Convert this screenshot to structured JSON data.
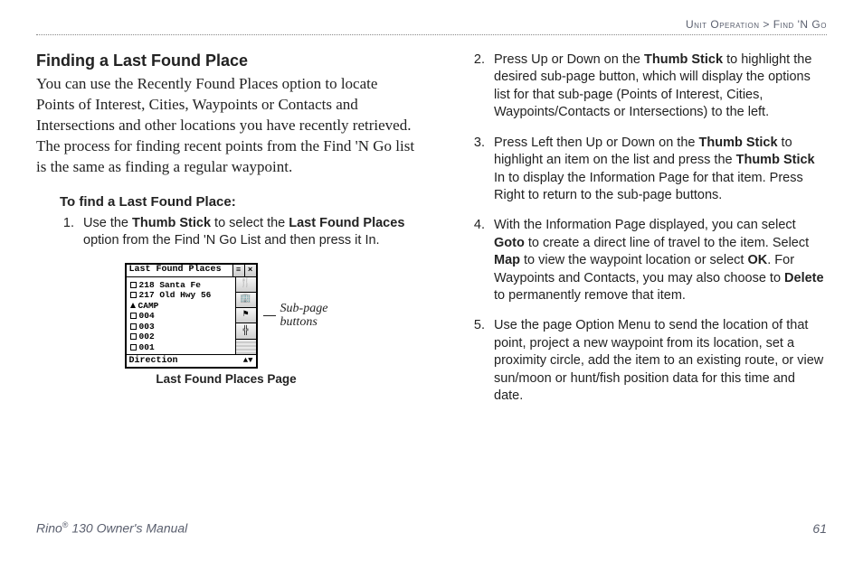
{
  "header": {
    "breadcrumb_left": "Unit Operation",
    "breadcrumb_sep": " > ",
    "breadcrumb_right": "Find 'N Go"
  },
  "left": {
    "title": "Finding a Last Found Place",
    "intro": "You can use the Recently Found Places option to locate Points of Interest, Cities, Waypoints or Contacts and Intersections and other locations you have recently retrieved. The process for finding recent points from the Find 'N Go list is the same as finding a regular waypoint.",
    "sub_head": "To find a Last Found Place:",
    "step1_pre": "Use the ",
    "step1_b1": "Thumb Stick",
    "step1_mid": " to select the ",
    "step1_b2": "Last Found Places",
    "step1_post": " option from the Find 'N Go List and then press it In.",
    "figure": {
      "win_title": "Last Found Places",
      "items": [
        {
          "icon": "sq",
          "label": "218 Santa Fe"
        },
        {
          "icon": "sq",
          "label": "217 Old Hwy 56"
        },
        {
          "icon": "camp",
          "label": "CAMP"
        },
        {
          "icon": "sq",
          "label": "004"
        },
        {
          "icon": "sq",
          "label": "003"
        },
        {
          "icon": "sq",
          "label": "002"
        },
        {
          "icon": "sq",
          "label": "001"
        }
      ],
      "footer_label": "Direction",
      "callout_l1": "Sub-page",
      "callout_l2": "buttons",
      "caption": "Last Found Places Page"
    }
  },
  "right": {
    "step2_pre": "Press Up or Down on the ",
    "step2_b1": "Thumb Stick",
    "step2_post": " to highlight the desired sub-page button, which will display the options list for that sub-page (Points of Interest, Cities, Waypoints/Contacts or Intersections) to the left.",
    "step3_pre": "Press Left then Up or Down on the ",
    "step3_b1": "Thumb Stick",
    "step3_mid": " to highlight an item on the list and press the ",
    "step3_b2": "Thumb Stick",
    "step3_post": " In to display the Information Page for that item. Press Right to return to the sub-page buttons.",
    "step4_pre": "With the Information Page displayed, you can select ",
    "step4_b1": "Goto",
    "step4_m1": " to create a direct line of travel to the item. Select ",
    "step4_b2": "Map",
    "step4_m2": " to view the waypoint location or select ",
    "step4_b3": "OK",
    "step4_m3": ". For Waypoints and Contacts, you may also choose to ",
    "step4_b4": "Delete",
    "step4_post": " to permanently remove that item.",
    "step5": "Use the page Option Menu to send the location of that point, project a new waypoint from its location, set a proximity circle, add the item to an existing route, or view sun/moon or hunt/fish position data for this time and date."
  },
  "footer": {
    "product_pre": "Rino",
    "product_sup": "®",
    "product_post": " 130 Owner's Manual",
    "page_num": "61"
  }
}
